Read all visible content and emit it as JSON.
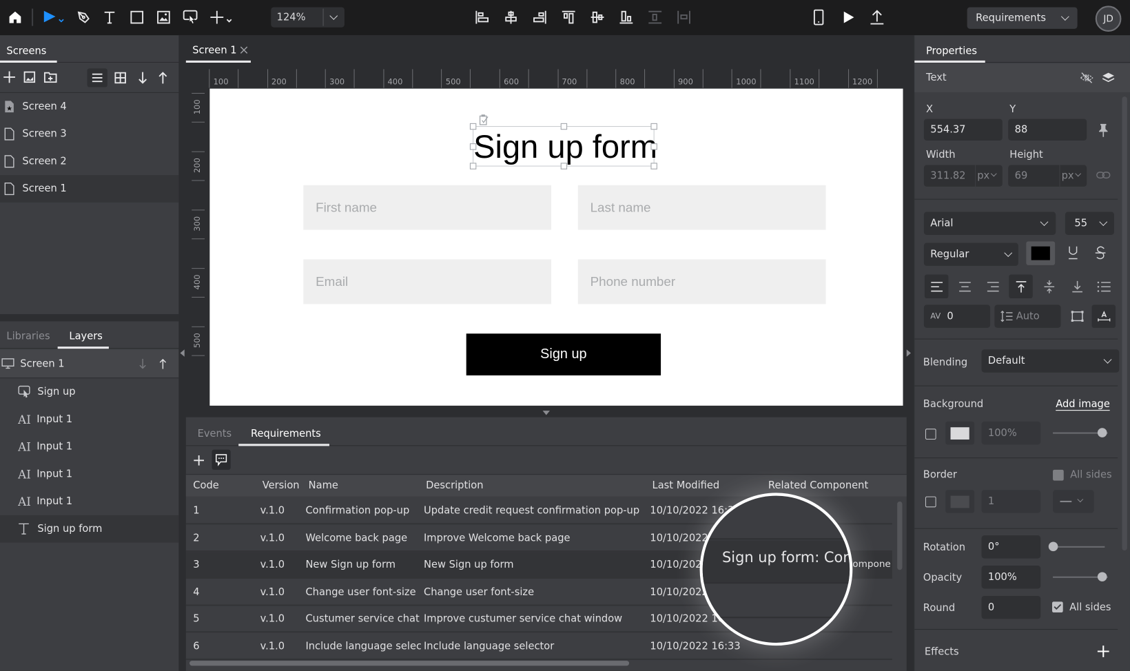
{
  "toolbar": {
    "zoom_level": "124%",
    "mode_select": "Requirements",
    "avatar_initials": "JD",
    "accent_color": "#1e90ff"
  },
  "screens_panel": {
    "tab_label": "Screens",
    "items": [
      {
        "label": "Screen 4",
        "icon": "starred-page-icon"
      },
      {
        "label": "Screen 3",
        "icon": "page-icon"
      },
      {
        "label": "Screen 2",
        "icon": "page-icon"
      },
      {
        "label": "Screen 1",
        "icon": "page-icon",
        "selected": true
      }
    ]
  },
  "layers_panel": {
    "tabs": [
      "Libraries",
      "Layers"
    ],
    "active_tab": "Layers",
    "root": "Screen 1",
    "items": [
      {
        "label": "Sign up",
        "icon": "hotspot-icon"
      },
      {
        "label": "Input 1",
        "icon": "input-icon"
      },
      {
        "label": "Input 1",
        "icon": "input-icon"
      },
      {
        "label": "Input 1",
        "icon": "input-icon"
      },
      {
        "label": "Input 1",
        "icon": "input-icon"
      },
      {
        "label": "Sign up form",
        "icon": "text-icon",
        "selected": true
      }
    ]
  },
  "document": {
    "tab_label": "Screen 1",
    "h_ruler": [
      "100",
      "200",
      "300",
      "400",
      "500",
      "600",
      "700",
      "800",
      "900",
      "1000",
      "1100",
      "1200"
    ],
    "v_ruler": [
      "100",
      "200",
      "300",
      "400",
      "500"
    ],
    "form": {
      "title": "Sign up form",
      "first_name_placeholder": "First name",
      "last_name_placeholder": "Last name",
      "email_placeholder": "Email",
      "phone_placeholder": "Phone number",
      "submit_label": "Sign up"
    }
  },
  "bottom_panel": {
    "tabs": [
      "Events",
      "Requirements"
    ],
    "active_tab": "Requirements",
    "columns": [
      "Code",
      "Version",
      "Name",
      "Description",
      "Last Modified",
      "Related Component"
    ],
    "rows": [
      {
        "code": "1",
        "version": "v.1.0",
        "name": "Confirmation pop-up",
        "description": "Update credit request confirmation pop-up",
        "modified": "10/10/2022 16:31",
        "component": ""
      },
      {
        "code": "2",
        "version": "v.1.0",
        "name": "Welcome back page",
        "description": "Improve Welcome back page",
        "modified": "10/10/2022 16:31",
        "component": ""
      },
      {
        "code": "3",
        "version": "v.1.0",
        "name": "New Sign up form",
        "description": "New Sign up form",
        "modified": "10/10/2022 16:32",
        "component": "Sign up form: Component"
      },
      {
        "code": "4",
        "version": "v.1.0",
        "name": "Change user font-size",
        "description": "Change user font-size",
        "modified": "10/10/2022 16:32",
        "component": ""
      },
      {
        "code": "5",
        "version": "v.1.0",
        "name": "Custumer service chat ...",
        "description": "Improve custumer service chat window",
        "modified": "10/10/2022 16:33",
        "component": ""
      },
      {
        "code": "6",
        "version": "v.1.0",
        "name": "Include language selec...",
        "description": "Include language selector",
        "modified": "10/10/2022 16:33",
        "component": ""
      }
    ],
    "magnifier_text": "Sign up form: Cor",
    "magnifier_tail": "ompone"
  },
  "properties": {
    "tab_label": "Properties",
    "section": "Text",
    "x_label": "X",
    "x_value": "554.37",
    "y_label": "Y",
    "y_value": "88",
    "width_label": "Width",
    "width_value": "311.82",
    "width_unit": "px",
    "height_label": "Height",
    "height_value": "69",
    "height_unit": "px",
    "font_family": "Arial",
    "font_size": "55",
    "font_weight": "Regular",
    "text_color": "#000000",
    "letter_spacing": "0",
    "line_height": "Auto",
    "blending_label": "Blending",
    "blending_value": "Default",
    "background_label": "Background",
    "add_image_label": "Add image",
    "background_opacity": "100%",
    "border_label": "Border",
    "border_all_sides": "All sides",
    "border_width": "1",
    "rotation_label": "Rotation",
    "rotation_value": "0°",
    "opacity_label": "Opacity",
    "opacity_value": "100%",
    "opacity_fraction": 1.0,
    "rotation_fraction": 0.0,
    "background_opacity_fraction": 1.0,
    "round_label": "Round",
    "round_value": "0",
    "round_all_sides": "All sides",
    "effects_label": "Effects"
  }
}
